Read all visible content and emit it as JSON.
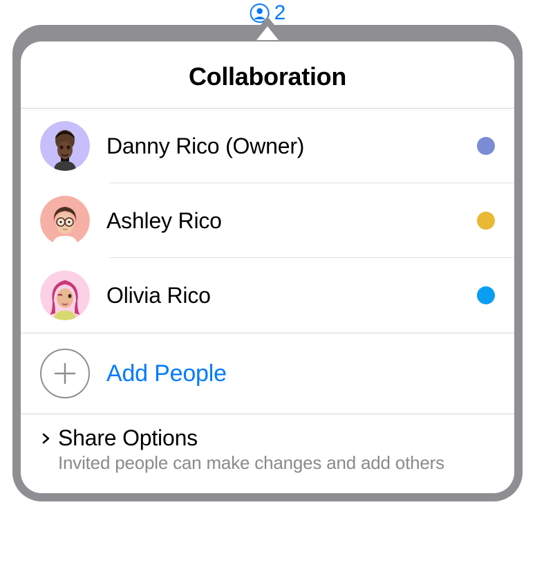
{
  "toolbar": {
    "count": "2"
  },
  "popover": {
    "title": "Collaboration",
    "participants": [
      {
        "name": "Danny Rico (Owner)",
        "avatarBg": "#c6bffb",
        "statusColor": "#7a8cd6"
      },
      {
        "name": "Ashley Rico",
        "avatarBg": "#f7b0a5",
        "statusColor": "#e9b933"
      },
      {
        "name": "Olivia Rico",
        "avatarBg": "#fcd1e5",
        "statusColor": "#0a9ef2"
      }
    ],
    "addPeople": {
      "label": "Add People"
    },
    "shareOptions": {
      "title": "Share Options",
      "subtitle": "Invited people can make changes and add others"
    }
  }
}
